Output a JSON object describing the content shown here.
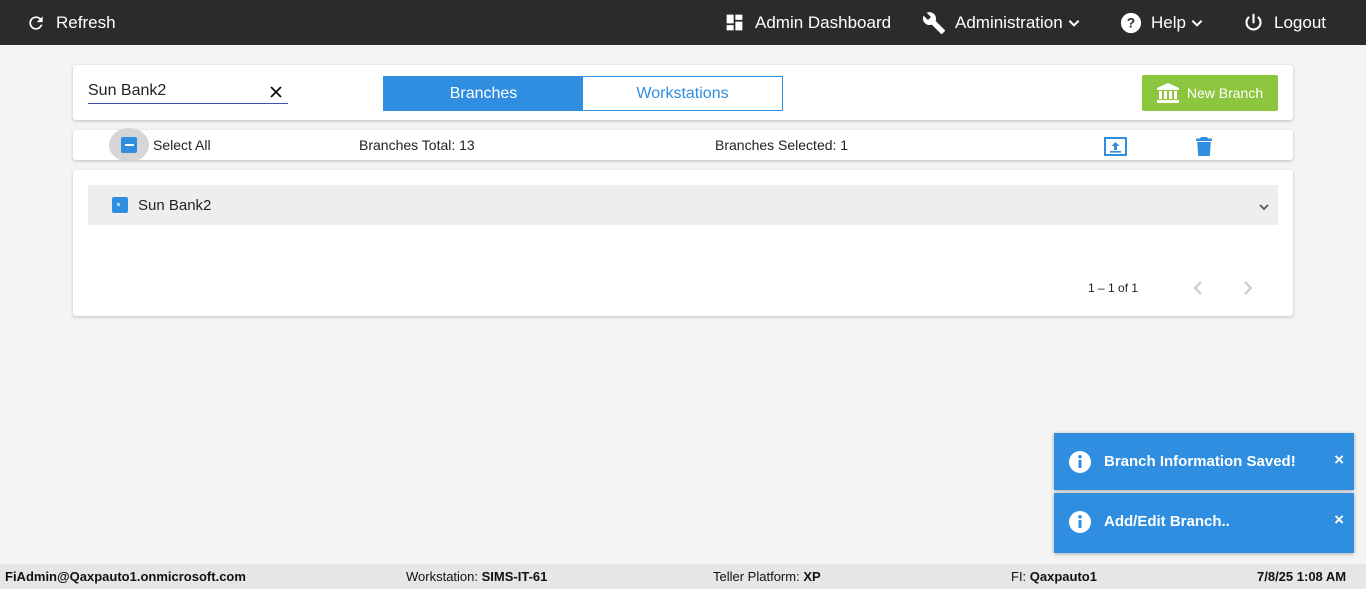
{
  "topbar": {
    "refresh_label": "Refresh",
    "dashboard_label": "Admin Dashboard",
    "administration_label": "Administration",
    "help_label": "Help",
    "logout_label": "Logout"
  },
  "search": {
    "value": "Sun Bank2",
    "clear_icon": "close-icon"
  },
  "tabs": [
    {
      "label": "Branches",
      "active": true
    },
    {
      "label": "Workstations",
      "active": false
    }
  ],
  "new_branch_label": "New Branch",
  "selection_bar": {
    "select_all_label": "Select All",
    "total_label": "Branches Total: 13",
    "selected_label": "Branches Selected: 1"
  },
  "branches": [
    {
      "name": "Sun Bank2",
      "checked": true
    }
  ],
  "paginator": {
    "range_label": "1 – 1 of 1"
  },
  "toasts": [
    {
      "message": "Branch Information Saved!",
      "close": "×"
    },
    {
      "message": "Add/Edit Branch..",
      "close": "×"
    }
  ],
  "footer": {
    "user": "FiAdmin@Qaxpauto1.onmicrosoft.com",
    "workstation_label": "Workstation:",
    "workstation_value": "SIMS-IT-61",
    "platform_label": "Teller Platform:",
    "platform_value": "XP",
    "fi_label": "FI:",
    "fi_value": "Qaxpauto1",
    "datetime": "7/8/25 1:08 AM"
  },
  "colors": {
    "topbar": "#2b2b2b",
    "accent": "#2f8ee0",
    "new_branch": "#8cc63f"
  }
}
